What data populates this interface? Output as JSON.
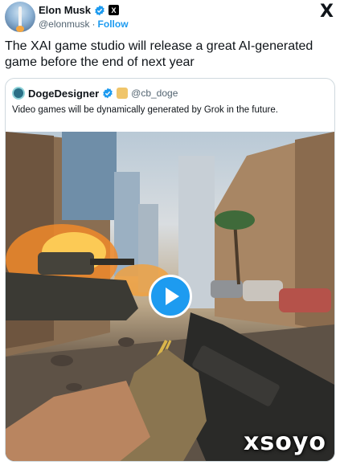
{
  "author": {
    "name": "Elon Musk",
    "handle": "@elonmusk",
    "separator": "·",
    "follow_label": "Follow",
    "x_badge": "X",
    "platform_logo": "X"
  },
  "tweet": {
    "text": "The XAI game studio will release a great AI-generated game before the end of next year"
  },
  "quote": {
    "name": "DogeDesigner",
    "handle": "@cb_doge",
    "text": "Video games will be dynamically generated by Grok in the future."
  },
  "media": {
    "type": "video",
    "watermark": "xsoyo",
    "icons": [
      "play-icon"
    ]
  },
  "colors": {
    "accent": "#1d9bf0",
    "text": "#0f1419",
    "muted": "#536471",
    "border": "#cfd9de"
  }
}
